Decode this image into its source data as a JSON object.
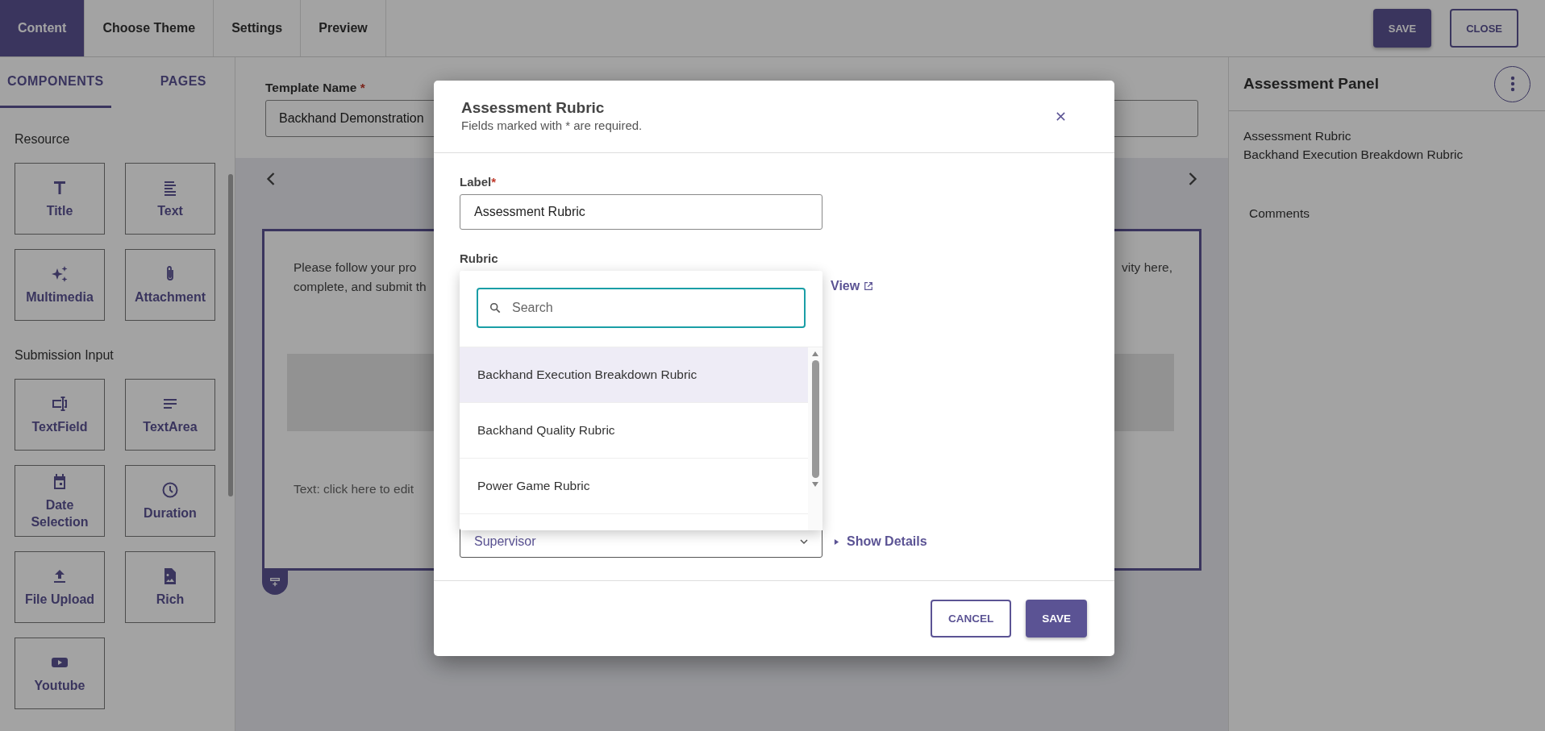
{
  "top_tabs": [
    {
      "label": "Content",
      "selected": true
    },
    {
      "label": "Choose Theme",
      "selected": false
    },
    {
      "label": "Settings",
      "selected": false
    },
    {
      "label": "Preview",
      "selected": false
    }
  ],
  "actions": {
    "save": "SAVE",
    "close": "CLOSE"
  },
  "sidebar": {
    "tabs": [
      {
        "label": "COMPONENTS",
        "selected": true
      },
      {
        "label": "PAGES",
        "selected": false
      }
    ],
    "sections": [
      {
        "title": "Resource",
        "items": [
          {
            "label": "Title",
            "kind": "title"
          },
          {
            "label": "Text",
            "kind": "text"
          },
          {
            "label": "Multimedia",
            "kind": "multimedia"
          },
          {
            "label": "Attachment",
            "kind": "attachment"
          }
        ]
      },
      {
        "title": "Submission Input",
        "items": [
          {
            "label": "TextField",
            "kind": "textfield"
          },
          {
            "label": "TextArea",
            "kind": "textarea"
          },
          {
            "label": "Date Selection",
            "kind": "date"
          },
          {
            "label": "Duration",
            "kind": "duration"
          },
          {
            "label": "File Upload",
            "kind": "upload"
          },
          {
            "label": "Rich",
            "kind": "rich"
          },
          {
            "label": "Youtube",
            "kind": "youtube"
          }
        ]
      }
    ]
  },
  "editor": {
    "template_name_label": "Template Name",
    "required_mark": "*",
    "template_name_value": "Backhand Demonstration",
    "card_text_lines": [
      "Please follow your pro",
      "complete, and submit th"
    ],
    "card_text_right": "vity here,",
    "text_placeholder": "Text: click here to edit"
  },
  "assessment_panel": {
    "title": "Assessment Panel",
    "item_label": "Assessment Rubric",
    "item_value": "Backhand Execution Breakdown Rubric",
    "comments": "Comments"
  },
  "dialog": {
    "title": "Assessment Rubric",
    "subtitle": "Fields marked with * are required.",
    "label_field": {
      "label": "Label",
      "required_mark": "*",
      "value": "Assessment Rubric"
    },
    "rubric_label": "Rubric",
    "view_link": "View",
    "dropdown": {
      "search_placeholder": "Search",
      "options": [
        {
          "label": "Backhand Execution Breakdown Rubric",
          "selected": true
        },
        {
          "label": "Backhand Quality Rubric",
          "selected": false
        },
        {
          "label": "Power Game Rubric",
          "selected": false
        }
      ]
    },
    "role_select": {
      "value": "Supervisor"
    },
    "show_details": "Show Details",
    "buttons": {
      "cancel": "CANCEL",
      "save": "SAVE"
    }
  }
}
